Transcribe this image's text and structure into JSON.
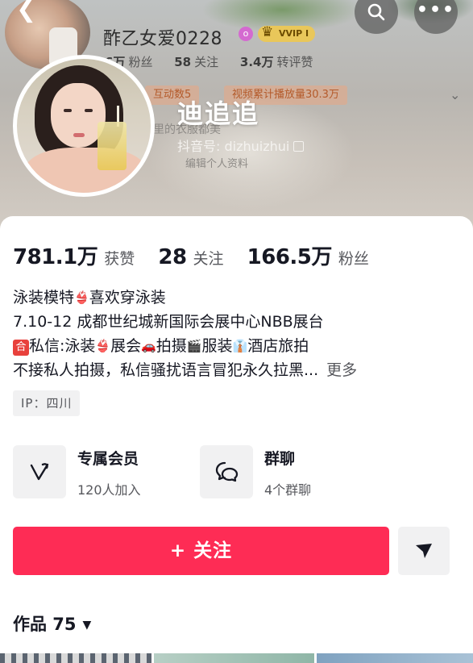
{
  "header": {
    "bg_name": "酢乙女爱0228",
    "bg_badge_o": "o",
    "bg_vip": "VVIP I",
    "bg_stats": [
      {
        "num": "6万",
        "label": "粉丝"
      },
      {
        "num": "58",
        "label": "关注"
      },
      {
        "num": "3.4万",
        "label": "转评赞"
      }
    ],
    "bg_tags": [
      "互动数5",
      "视频累计播放量30.3万"
    ],
    "bg_faint1": "里的衣服都美",
    "bg_faint2": "编辑个人资料",
    "nickname": "迪追追",
    "douyin_id": "抖音号: dizhuizhui"
  },
  "profile": {
    "stats": [
      {
        "num": "781.1万",
        "label": "获赞"
      },
      {
        "num": "28",
        "label": "关注"
      },
      {
        "num": "166.5万",
        "label": "粉丝"
      }
    ],
    "bio": {
      "line1": "泳装模特",
      "line1_after": "喜欢穿泳装",
      "line2": "7.10-12 成都世纪城新国际会展中心NBB展台",
      "line3_badge": "合",
      "line3_a": "私信:泳装",
      "line3_b": "展会",
      "line3_c": "拍摄",
      "line3_d": "服装",
      "line3_e": "酒店旅拍",
      "line4": "不接私人拍摄，私信骚扰语言冒犯永久拉黑...",
      "more": "更多"
    },
    "ip": "IP：四川",
    "entries": {
      "vip": {
        "title": "专属会员",
        "sub": "120人加入"
      },
      "group": {
        "title": "群聊",
        "sub": "4个群聊"
      }
    },
    "follow_label": "+ 关注",
    "works_tab": "作品 75",
    "works_caret": "▼"
  },
  "colors": {
    "accent": "#fe2c55",
    "text_primary": "#161823",
    "text_secondary": "#57585d"
  }
}
